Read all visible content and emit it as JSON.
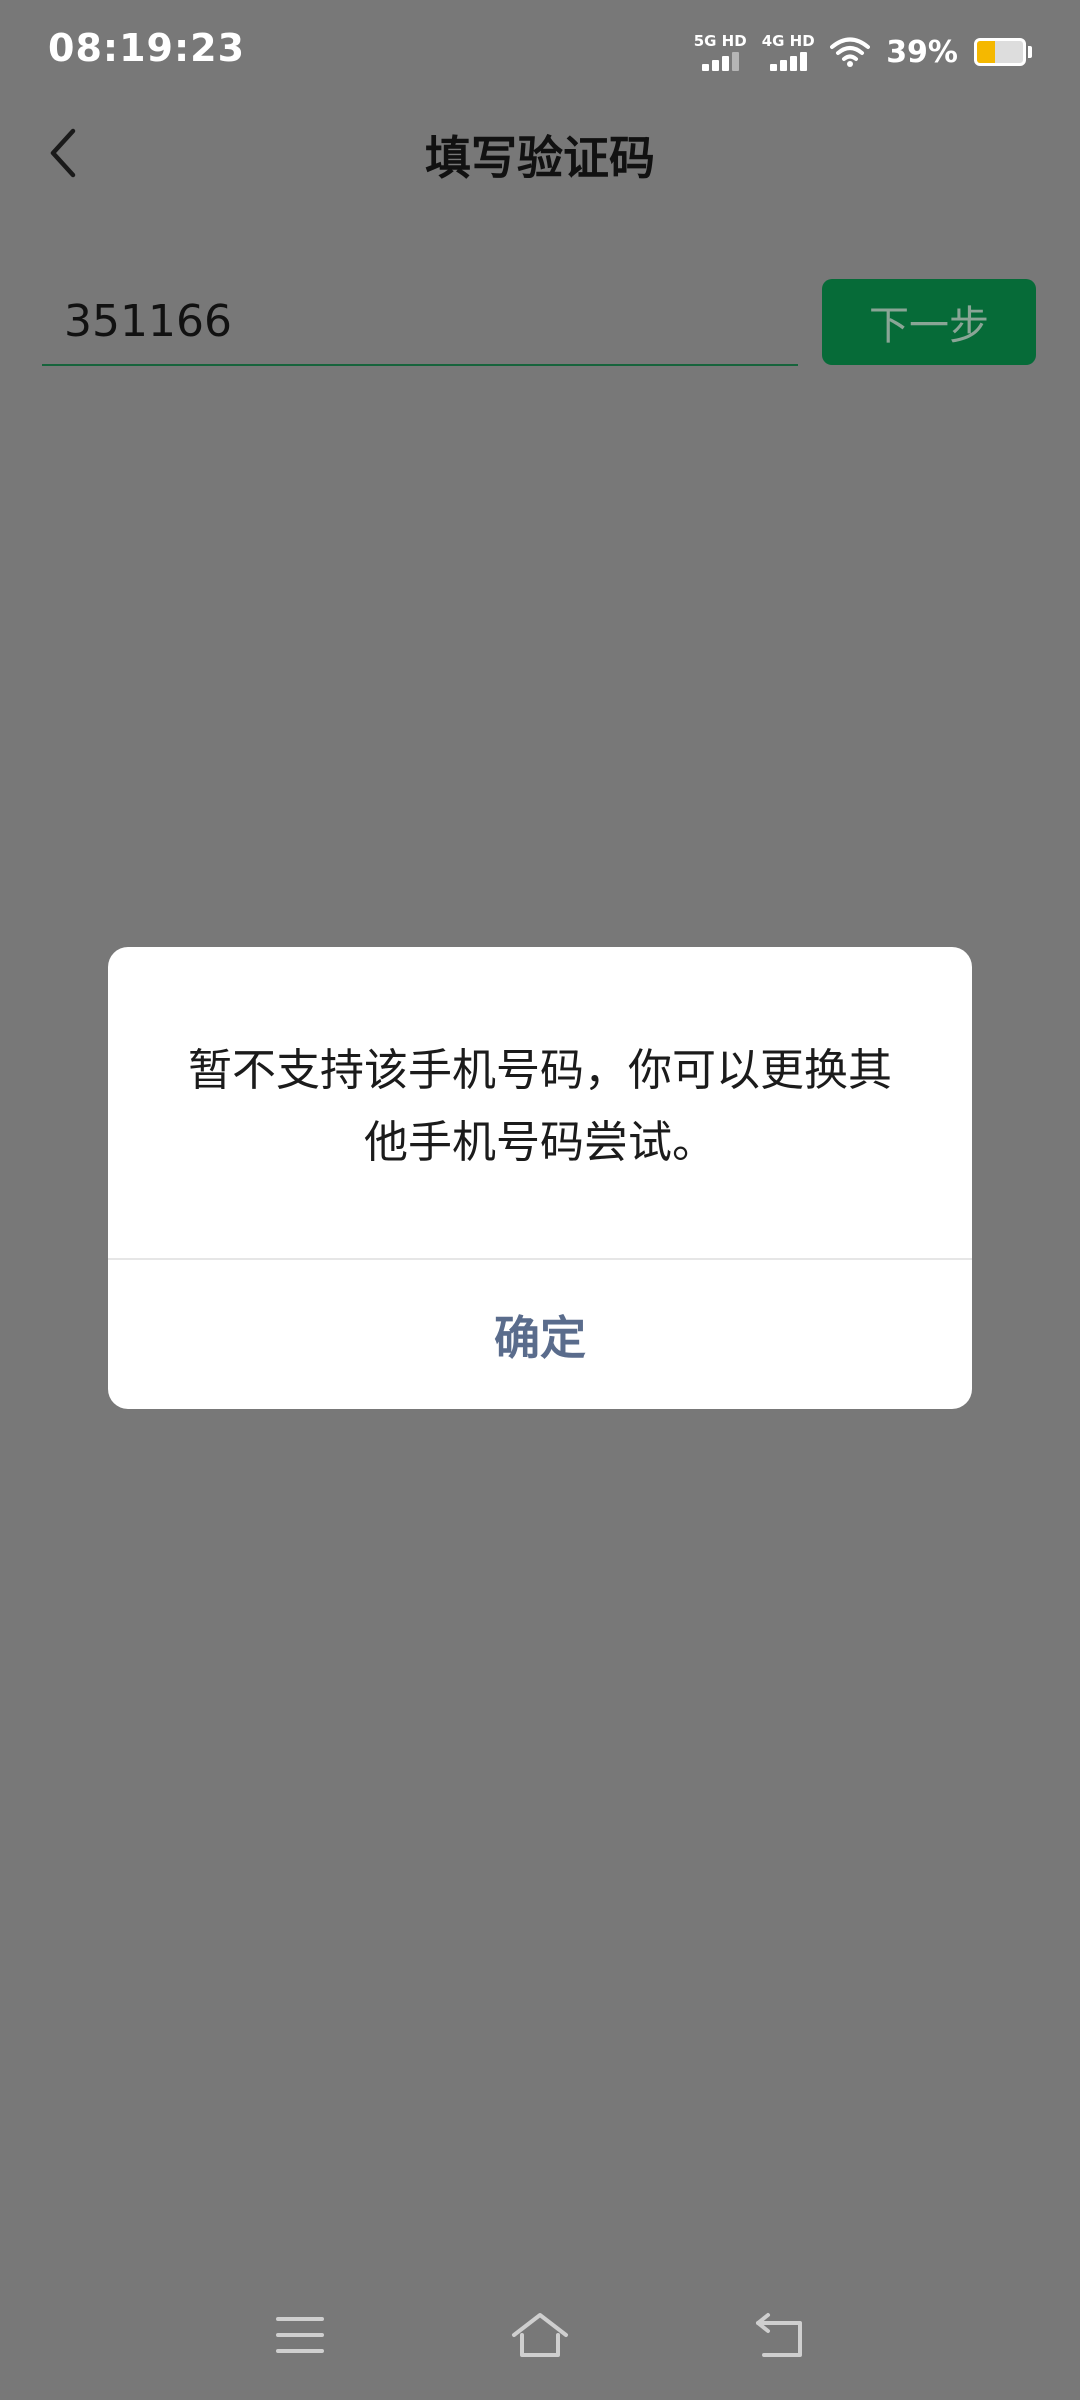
{
  "status_bar": {
    "time": "08:19:23",
    "sim1_label": "5G HD",
    "sim2_label": "4G HD",
    "battery_percent_text": "39%",
    "battery_level": 0.39,
    "battery_color": "#f5b800"
  },
  "header": {
    "back_icon": "chevron-left-icon",
    "title": "填写验证码"
  },
  "form": {
    "code_value": "351166",
    "next_label": "下一步"
  },
  "dialog": {
    "message": "暂不支持该手机号码，你可以更换其他手机号码尝试。",
    "confirm_label": "确定"
  },
  "nav_bar": {
    "icons": [
      "menu-icon",
      "home-icon",
      "back-icon"
    ]
  },
  "colors": {
    "overlay_background": "#787878",
    "primary_green": "#066b38",
    "dialog_action": "#5a6c8c"
  }
}
